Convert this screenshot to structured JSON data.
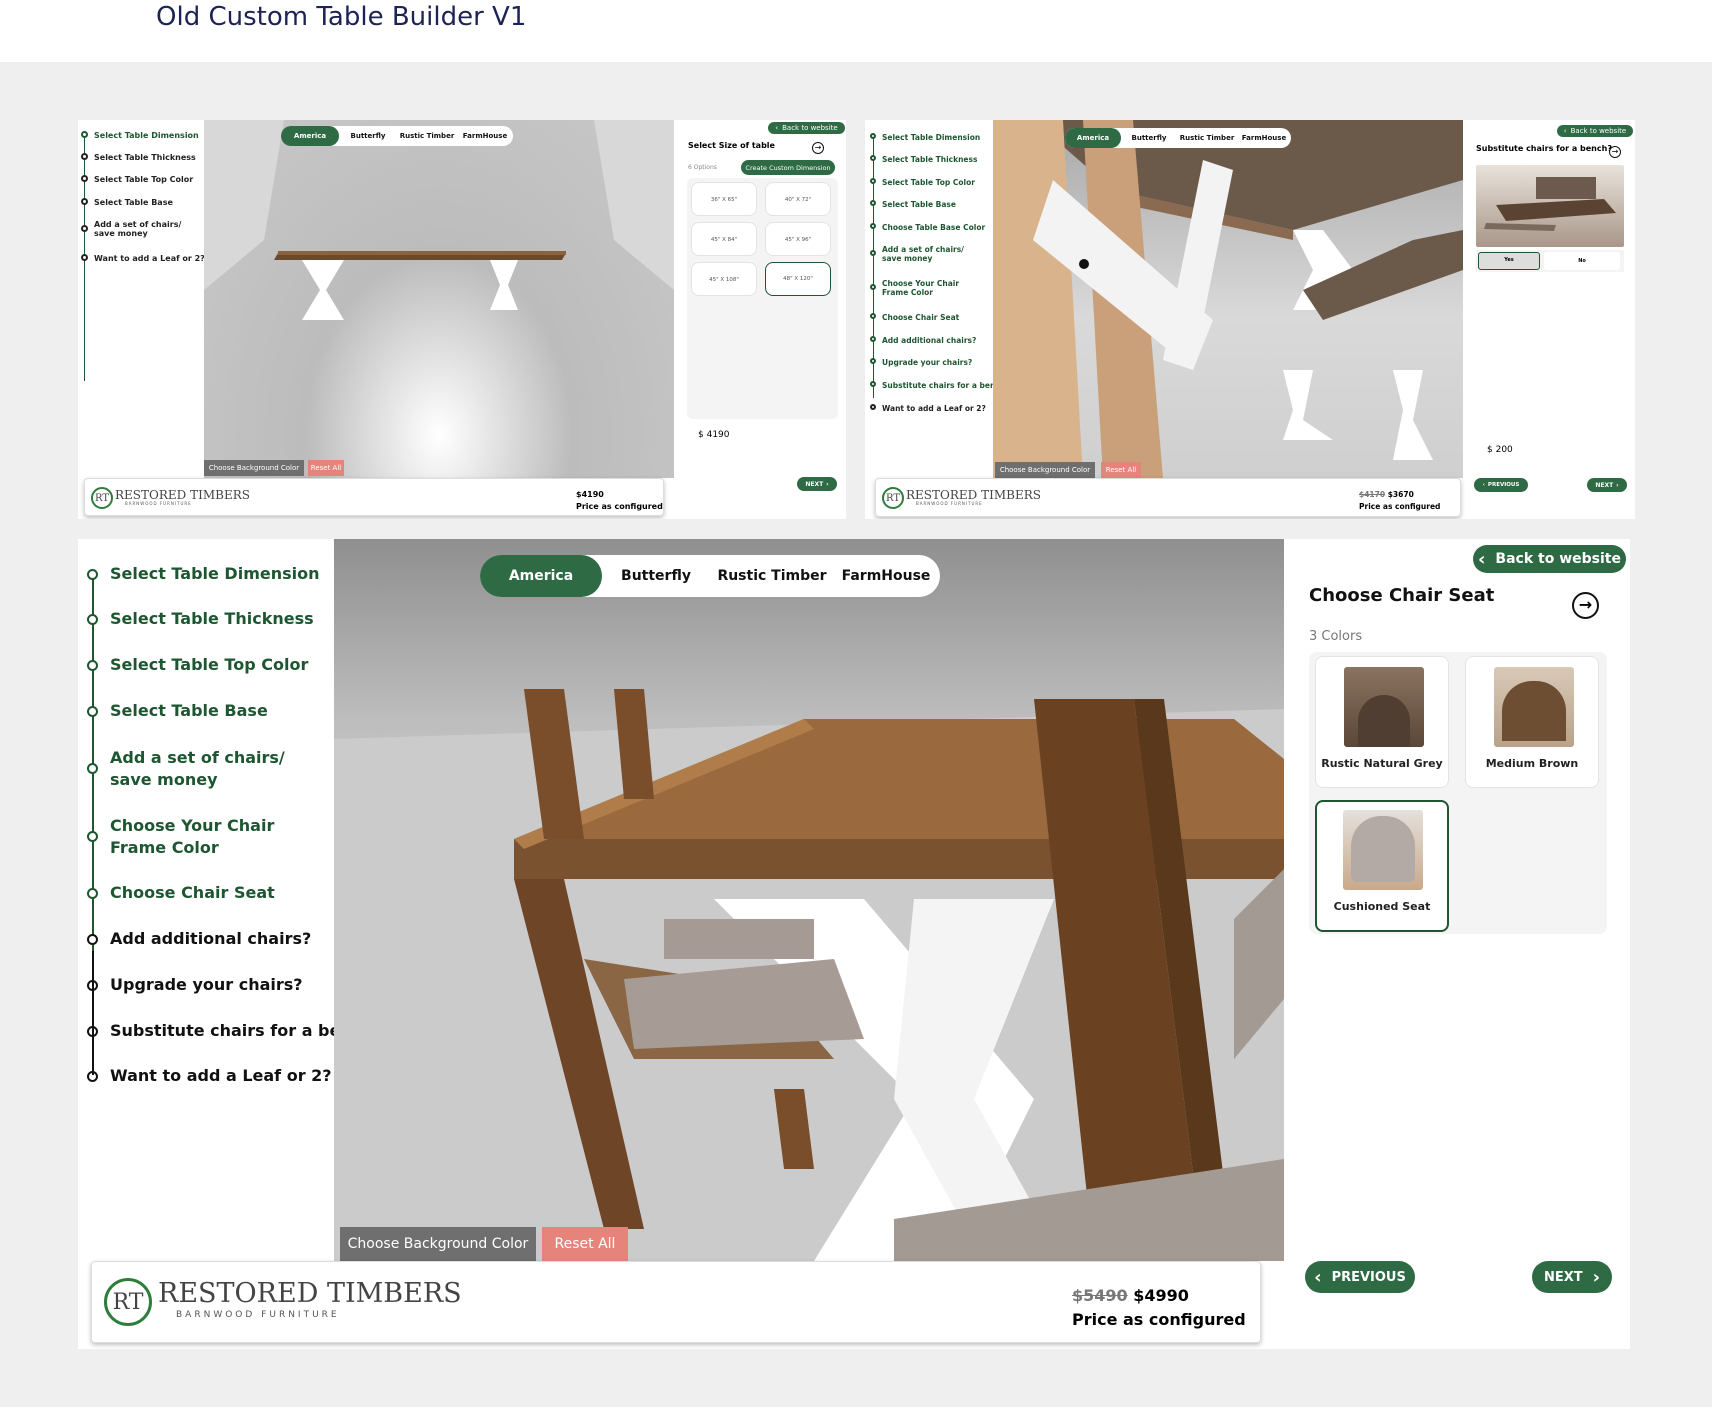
{
  "page_title": "Old Custom Table Builder V1",
  "colors": {
    "brand_green": "#2e6a44",
    "reset_red": "#e6847c",
    "title_navy": "#1d2354"
  },
  "tabs": [
    "America",
    "Butterfly",
    "Rustic Timber",
    "FarmHouse"
  ],
  "controls": {
    "bg_color": "Choose Background Color",
    "reset": "Reset All",
    "back": "Back to website",
    "next": "NEXT",
    "previous": "PREVIOUS"
  },
  "logo": {
    "mark": "RT",
    "name": "RESTORED TIMBERS",
    "sub": "BARNWOOD FURNITURE"
  },
  "price_caption": "Price as configured",
  "panel1": {
    "steps": [
      "Select Table Dimension",
      "Select Table Thickness",
      "Select Table Top Color",
      "Select Table Base",
      "Add a set of chairs/ save money",
      "Want to add a Leaf or 2?"
    ],
    "heading": "Select Size of table",
    "options_count": "6 Options",
    "custom_button": "Create Custom Dimension",
    "sizes": [
      "36\" X 65\"",
      "40\" X 72\"",
      "45\" X 84\"",
      "45\" X 96\"",
      "45\" X 108\"",
      "48\" X 120\""
    ],
    "side_price": "$ 4190",
    "footer_price": "$4190"
  },
  "panel2": {
    "steps": [
      "Select Table Dimension",
      "Select Table Thickness",
      "Select Table Top Color",
      "Select Table Base",
      "Choose Table Base Color",
      "Add a set of chairs/ save money",
      "Choose Your Chair Frame Color",
      "Choose Chair Seat",
      "Add additional chairs?",
      "Upgrade your chairs?",
      "Substitute chairs for a bench",
      "Want to add a Leaf or 2?"
    ],
    "heading": "Substitute chairs for a bench?",
    "yes": "Yes",
    "no": "No",
    "side_price": "$ 200",
    "old_price": "$4170",
    "new_price": "$3670"
  },
  "panel3": {
    "steps": [
      "Select Table Dimension",
      "Select Table Thickness",
      "Select Table Top Color",
      "Select Table Base",
      "Add a set of chairs/ save money",
      "Choose Your Chair Frame Color",
      "Choose Chair Seat",
      "Add additional chairs?",
      "Upgrade your chairs?",
      "Substitute chairs for a bench",
      "Want to add a Leaf or 2?"
    ],
    "heading": "Choose Chair Seat",
    "colors_count": "3 Colors",
    "seats": [
      {
        "name": "Rustic Natural Grey",
        "swatch": "#6b5746"
      },
      {
        "name": "Medium Brown",
        "swatch": "#7a5a3e"
      },
      {
        "name": "Cushioned Seat",
        "swatch": "#b4aaa5"
      }
    ],
    "old_price": "$5490",
    "new_price": "$4990"
  }
}
